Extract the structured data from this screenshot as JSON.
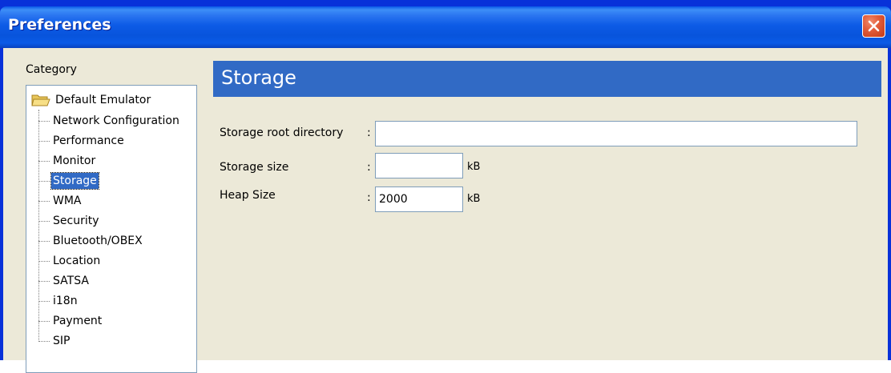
{
  "window": {
    "title": "Preferences"
  },
  "category": {
    "label": "Category",
    "root": "Default Emulator",
    "items": [
      {
        "label": "Network Configuration",
        "selected": false
      },
      {
        "label": "Performance",
        "selected": false
      },
      {
        "label": "Monitor",
        "selected": false
      },
      {
        "label": "Storage",
        "selected": true
      },
      {
        "label": "WMA",
        "selected": false
      },
      {
        "label": "Security",
        "selected": false
      },
      {
        "label": "Bluetooth/OBEX",
        "selected": false
      },
      {
        "label": "Location",
        "selected": false
      },
      {
        "label": "SATSA",
        "selected": false
      },
      {
        "label": "i18n",
        "selected": false
      },
      {
        "label": "Payment",
        "selected": false
      },
      {
        "label": "SIP",
        "selected": false
      }
    ]
  },
  "panel": {
    "title": "Storage",
    "fields": {
      "root_directory": {
        "label": "Storage root directory",
        "colon": ":",
        "value": ""
      },
      "storage_size": {
        "label": "Storage size",
        "colon": ":",
        "value": "",
        "unit": "kB"
      },
      "heap_size": {
        "label": "Heap Size",
        "colon": ":",
        "value": "2000",
        "unit": "kB"
      }
    }
  },
  "colors": {
    "title_bar": "#0854dc",
    "selection": "#316ac5",
    "dialog_background": "#ece9d8",
    "close_button": "#e35d3b"
  }
}
